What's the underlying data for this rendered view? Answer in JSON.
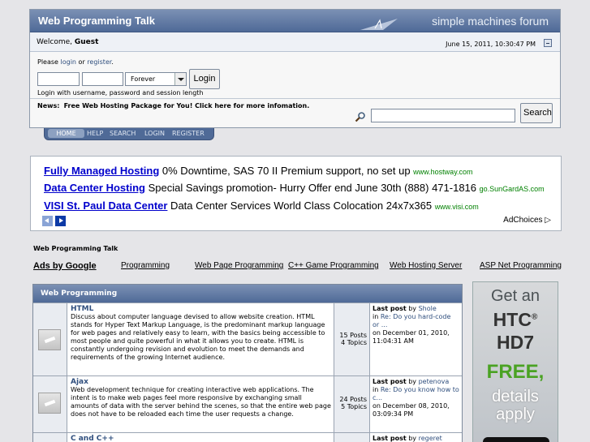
{
  "header": {
    "site_title": "Web Programming Talk",
    "logo_text": "simple machines forum",
    "welcome_prefix": "Welcome, ",
    "welcome_user": "Guest",
    "date": "June 15, 2011, 10:30:47 PM"
  },
  "login": {
    "please": "Please ",
    "login_link": "login",
    "or": " or ",
    "register_link": "register",
    "period": ".",
    "duration": "Forever",
    "login_button": "Login",
    "hint": "Login with username, password and session length"
  },
  "news": {
    "label": "News:",
    "text": "Free Web Hosting Package for You! Click here for more infomation.",
    "search_button": "Search"
  },
  "menu": [
    "HOME",
    "HELP",
    "SEARCH",
    "LOGIN",
    "REGISTER"
  ],
  "ads": [
    {
      "title": "Fully Managed Hosting",
      "text": " 0% Downtime, SAS 70 II Premium support, no set up ",
      "url": "www.hostway.com"
    },
    {
      "title": "Data Center Hosting",
      "text": " Special Savings promotion- Hurry Offer end June 30th (888) 471-1816 ",
      "url": "go.SunGardAS.com"
    },
    {
      "title": "VISI St. Paul Data Center",
      "text": " Data Center Services World Class Colocation 24x7x365 ",
      "url": "www.visi.com"
    }
  ],
  "adchoices": "AdChoices",
  "breadcrumb": "Web Programming Talk",
  "ad_links": {
    "ads_by_google": "Ads by Google",
    "links": [
      "Programming",
      "Web Page Programming",
      "C++ Game Programming",
      "Web Hosting Server",
      "ASP Net Programming"
    ]
  },
  "board": {
    "category": "Web Programming",
    "rows": [
      {
        "name": "HTML",
        "description": "Discuss about computer language devised to allow website creation. HTML stands for Hyper Text Markup Language, is the predominant markup language for web pages and relatively easy to learn, with the basics being accessible to most people and quite powerful in what it allows you to create. HTML is constantly undergoing revision and evolution to meet the demands and requirements of the growing Internet audience.",
        "posts": "15 Posts",
        "topics": "4 Topics",
        "last_post_label": "Last post",
        "by": " by ",
        "last_user": "Shole",
        "in": "in ",
        "last_topic": "Re: Do you hard-code or ...",
        "on": "on December 01, 2010, 11:04:31 AM"
      },
      {
        "name": "Ajax",
        "description": "Web development technique for creating interactive web applications. The intent is to make web pages feel more responsive by exchanging small amounts of data with the server behind the scenes, so that the entire web page does not have to be reloaded each time the user requests a change.",
        "posts": "24 Posts",
        "topics": "5 Topics",
        "last_post_label": "Last post",
        "by": " by ",
        "last_user": "petenova",
        "in": "in ",
        "last_topic": "Re: Do you know how to c...",
        "on": "on December 08, 2010, 03:09:34 PM"
      },
      {
        "name": "C and C++",
        "last_post_label": "Last post",
        "by": " by ",
        "last_user": "regeret"
      }
    ]
  },
  "side_ad": {
    "line1": "Get an",
    "line2": "HTC",
    "reg": "®",
    "line3": "HD7",
    "line4": "FREE,",
    "line5": "details",
    "line6": "apply"
  }
}
